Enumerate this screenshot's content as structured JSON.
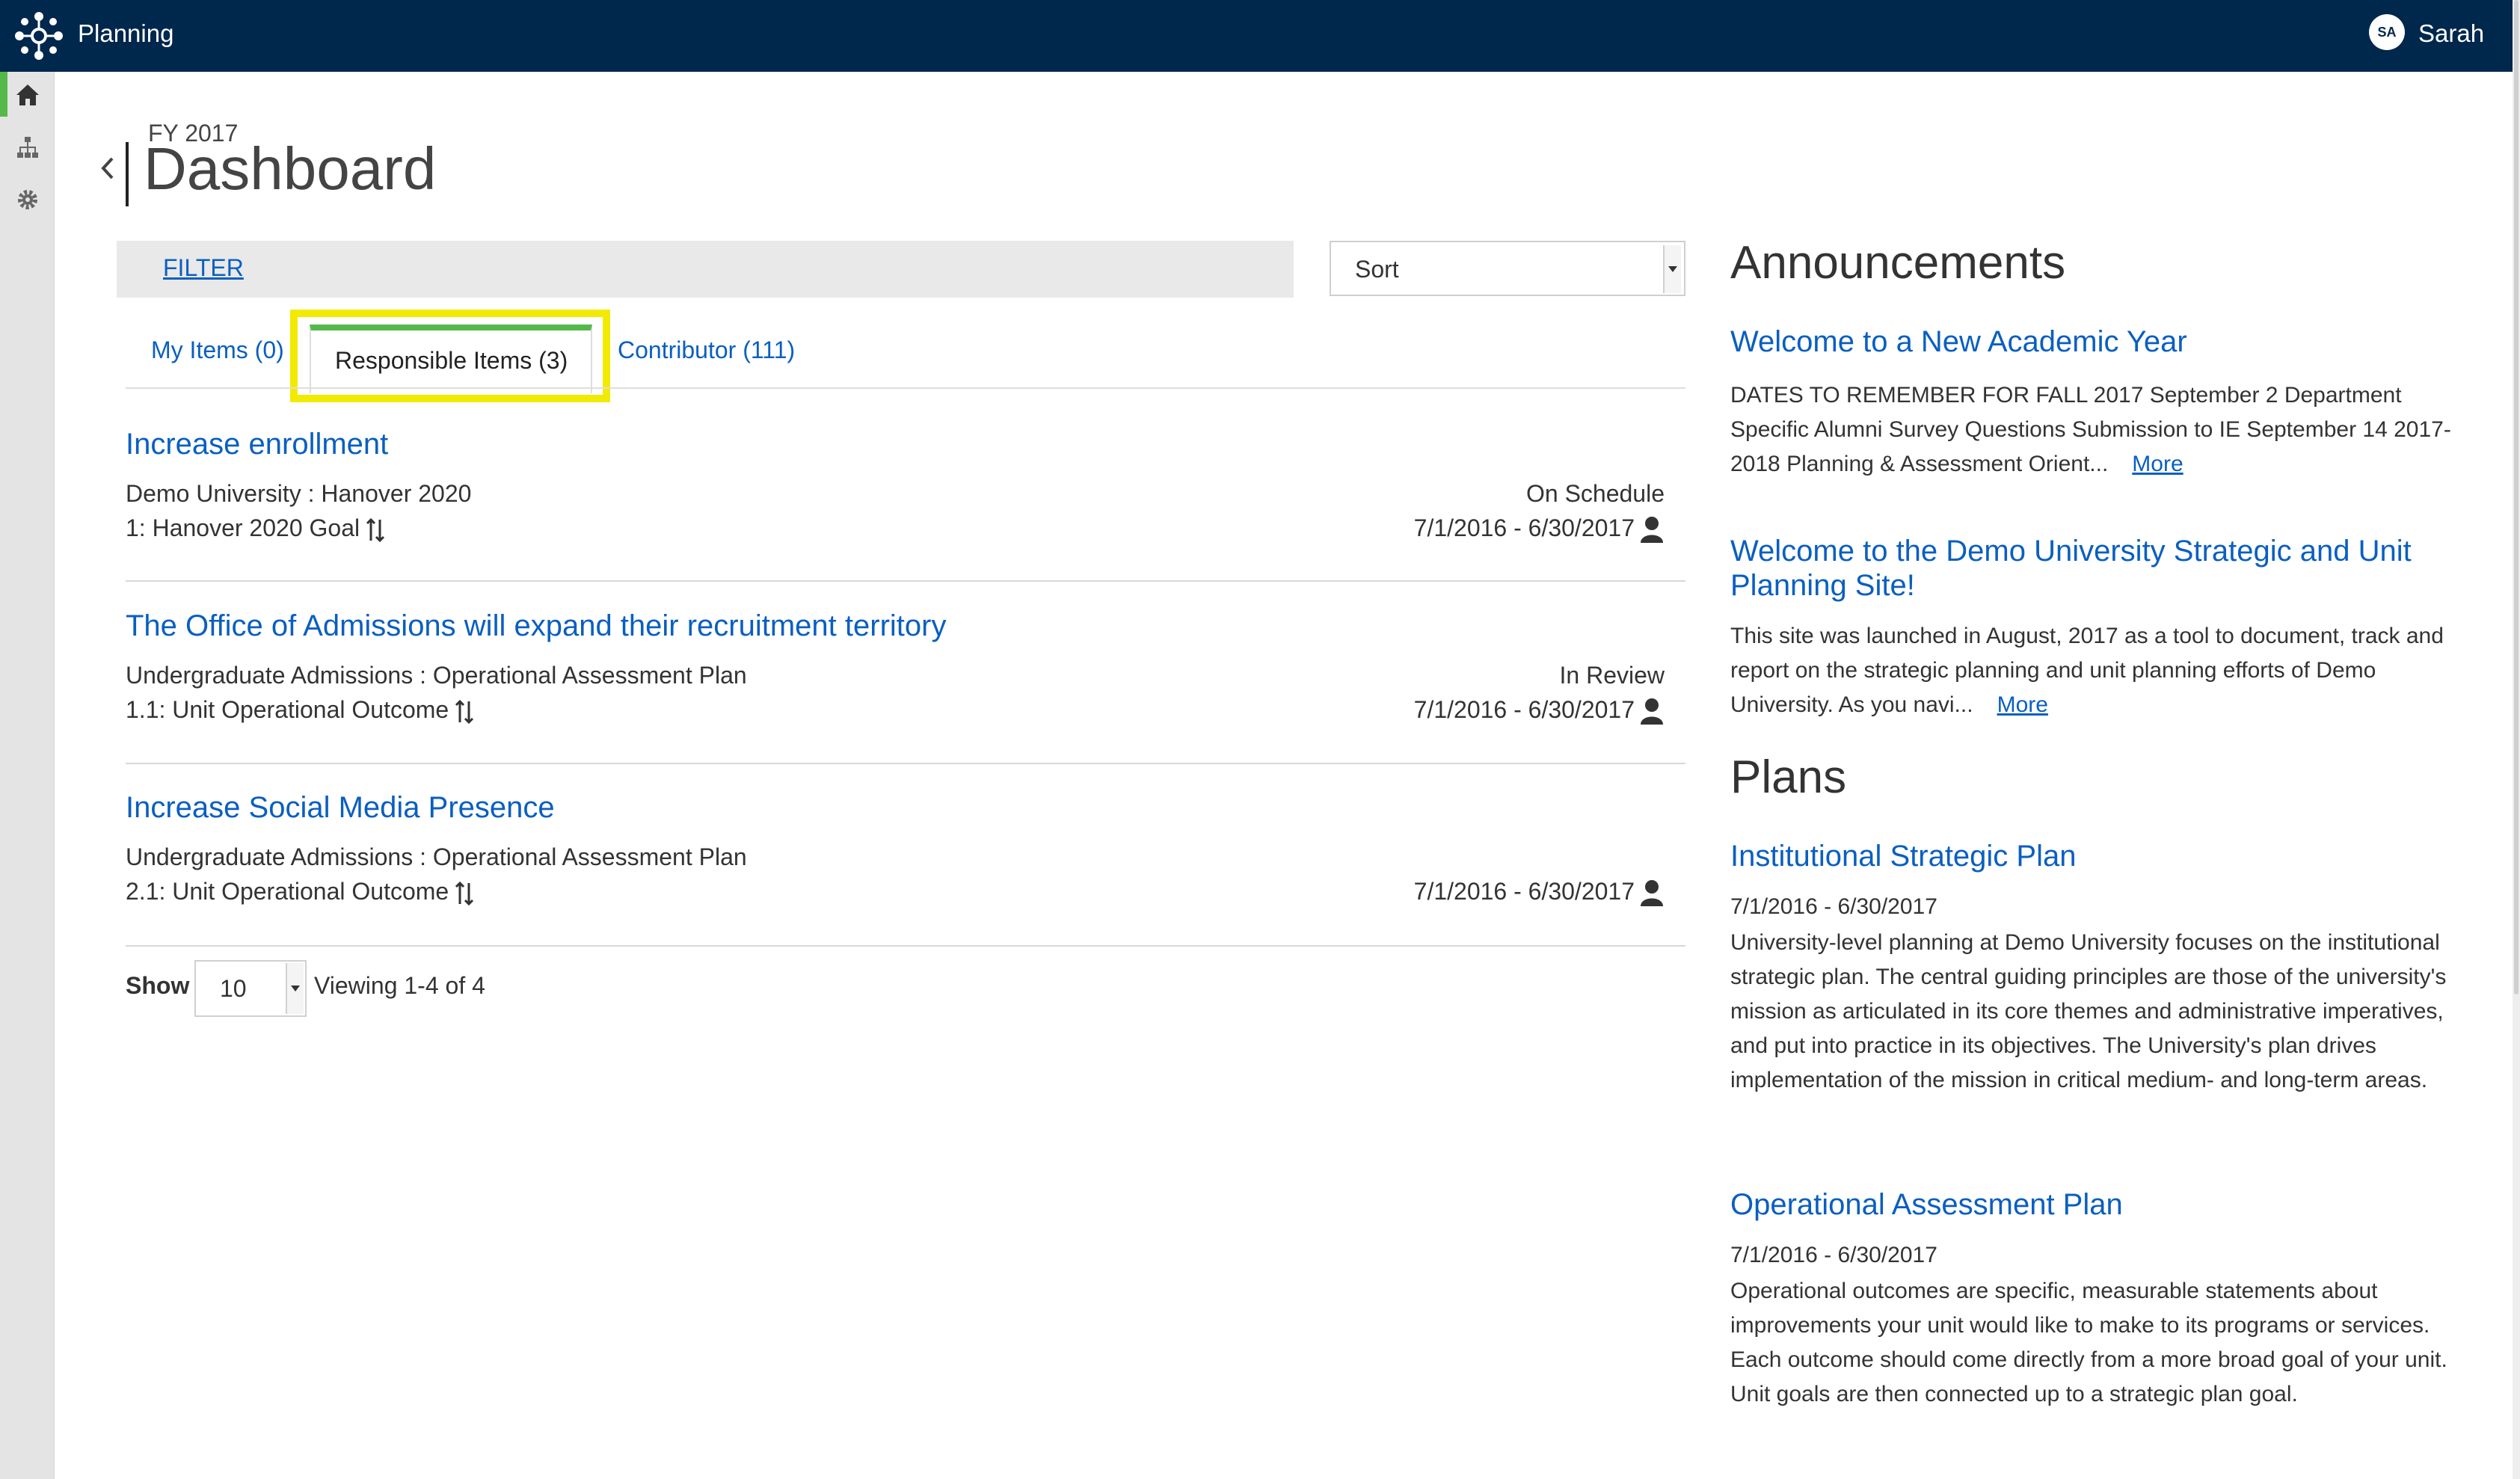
{
  "topbar": {
    "app_title": "Planning",
    "avatar_initials": "SA",
    "user_name": "Sarah",
    "background_color": "#00274c"
  },
  "sidebar": {
    "items": [
      {
        "icon": "home-icon",
        "active": true
      },
      {
        "icon": "org-chart-icon",
        "active": false
      },
      {
        "icon": "gear-icon",
        "active": false
      }
    ],
    "active_color": "#55b94a"
  },
  "header": {
    "fiscal_year": "FY 2017",
    "title": "Dashboard"
  },
  "toolbar": {
    "filter_label": "FILTER",
    "sort_label": "Sort"
  },
  "tabs": [
    {
      "label": "My Items (0)",
      "active": false
    },
    {
      "label": "Responsible Items (3)",
      "active": true
    },
    {
      "label": "Contributor (111)",
      "active": false
    }
  ],
  "items": [
    {
      "title": "Increase enrollment",
      "org": "Demo University : Hanover 2020",
      "goal": "1: Hanover 2020 Goal",
      "status": "On Schedule",
      "dates": "7/1/2016 - 6/30/2017"
    },
    {
      "title": "The Office of Admissions will expand their recruitment territory",
      "org": "Undergraduate Admissions : Operational Assessment Plan",
      "goal": "1.1: Unit Operational Outcome",
      "status": "In Review",
      "dates": "7/1/2016 - 6/30/2017"
    },
    {
      "title": "Increase Social Media Presence",
      "org": "Undergraduate Admissions : Operational Assessment Plan",
      "goal": "2.1: Unit Operational Outcome",
      "status": "",
      "dates": "7/1/2016 - 6/30/2017"
    }
  ],
  "pagination": {
    "show_label": "Show",
    "page_size": "10",
    "viewing": "Viewing 1-4 of 4"
  },
  "announcements": {
    "heading": "Announcements",
    "items": [
      {
        "title": "Welcome to a New Academic Year",
        "text": "DATES TO REMEMBER FOR FALL 2017 September 2 Department Specific Alumni Survey Questions Submission to IE September 14 2017-2018 Planning & Assessment Orient...",
        "more": "More"
      },
      {
        "title": "Welcome to the Demo University Strategic and Unit Planning Site!",
        "text": "This site was launched in August, 2017 as a tool to document, track and report on the strategic planning and unit planning efforts of Demo University. As you navi...",
        "more": "More"
      }
    ]
  },
  "plans": {
    "heading": "Plans",
    "items": [
      {
        "title": "Institutional Strategic Plan",
        "dates": "7/1/2016 - 6/30/2017",
        "text": "University-level planning at Demo University focuses on the institutional strategic plan. The central guiding principles are those of the university's mission as articulated in its core themes and administrative imperatives, and put into practice in its objectives. The University's plan drives implementation of the mission in critical medium- and long-term areas."
      },
      {
        "title": "Operational Assessment Plan",
        "dates": "7/1/2016 - 6/30/2017",
        "text": "Operational outcomes are specific, measurable statements about improvements your unit would like to make to its programs or services. Each outcome should come directly from a more broad goal of your unit. Unit goals are then connected up to a strategic plan goal."
      }
    ]
  },
  "colors": {
    "link": "#0a5fc0",
    "highlight": "#f2ea00",
    "active_tab_bar": "#55b94a"
  }
}
